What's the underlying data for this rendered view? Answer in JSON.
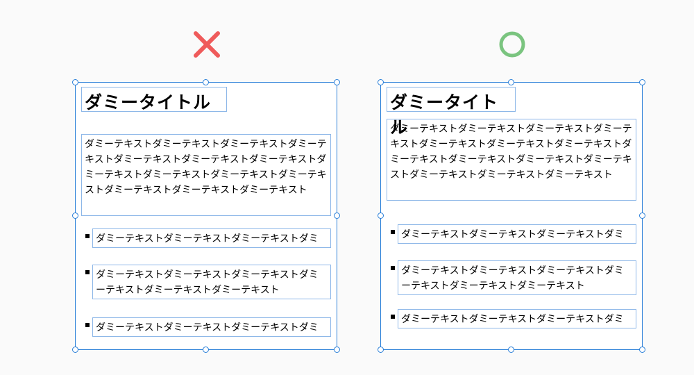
{
  "marks": {
    "cross": "×",
    "circle": "○"
  },
  "left_panel": {
    "title": "ダミータイトル",
    "body": "ダミーテキストダミーテキストダミーテキストダミーテキストダミーテキストダミーテキストダミーテキストダミーテキストダミーテキストダミーテキストダミーテキストダミーテキストダミーテキストダミーテキスト",
    "list": [
      "ダミーテキストダミーテキストダミーテキストダミ",
      "ダミーテキストダミーテキストダミーテキストダミーテキストダミーテキストダミーテキスト",
      "ダミーテキストダミーテキストダミーテキストダミ"
    ]
  },
  "right_panel": {
    "title": "ダミータイトル",
    "body": "ダミーテキストダミーテキストダミーテキストダミーテキストダミーテキストダミーテキストダミーテキストダミーテキストダミーテキストダミーテキストダミーテキストダミーテキストダミーテキストダミーテキスト",
    "list": [
      "ダミーテキストダミーテキストダミーテキストダミ",
      "ダミーテキストダミーテキストダミーテキストダミーテキストダミーテキストダミーテキスト",
      "ダミーテキストダミーテキストダミーテキストダミ"
    ]
  },
  "colors": {
    "selection": "#2a7fd8",
    "cross": "#ef5b5b",
    "circle": "#7ac47f"
  }
}
